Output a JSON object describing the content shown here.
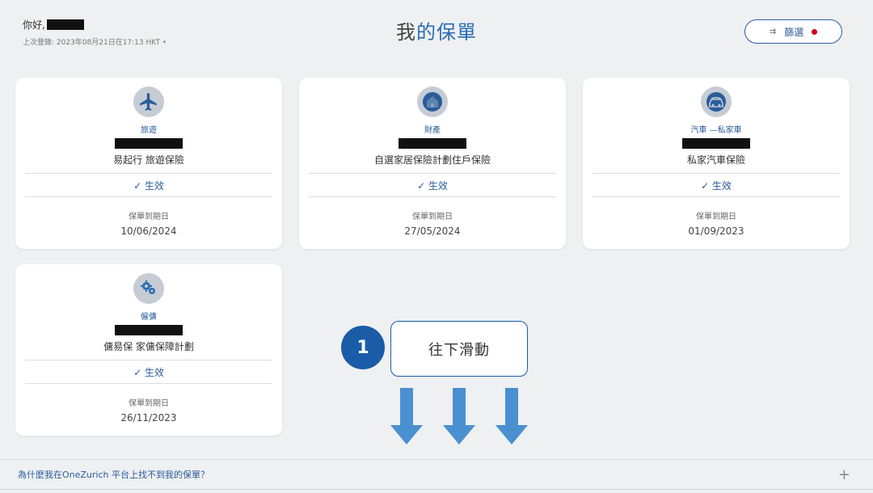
{
  "header": {
    "greeting": "你好,",
    "last_login": "上次登錄: 2023年08月21日在17:13 HKT •",
    "title_part1": "我",
    "title_part2": "的保單",
    "filter_label": "篩選",
    "filter_icon": "filter-icon"
  },
  "policies": [
    {
      "category": "旅遊",
      "product": "易起行 旅遊保險",
      "status": "✓ 生效",
      "expiry_label": "保單到期日",
      "expiry_date": "10/06/2024",
      "icon": "airplane-icon"
    },
    {
      "category": "財產",
      "product": "自選家居保險計劃住戶保險",
      "status": "✓ 生效",
      "expiry_label": "保單到期日",
      "expiry_date": "27/05/2024",
      "icon": "house-icon"
    },
    {
      "category": "汽車 —私家車",
      "product": "私家汽車保險",
      "status": "✓ 生效",
      "expiry_label": "保單到期日",
      "expiry_date": "01/09/2023",
      "icon": "car-icon"
    },
    {
      "category": "僱傭",
      "product": "傭易保 家傭保障計劃",
      "status": "✓ 生效",
      "expiry_label": "保單到期日",
      "expiry_date": "26/11/2023",
      "icon": "gears-icon"
    }
  ],
  "annotation": {
    "step_number": "1",
    "instruction": "往下滑動"
  },
  "faq": {
    "question": "為什麼我在OneZurich 平台上找不到我的保單？",
    "expand_icon": "+"
  },
  "colors": {
    "accent": "#2a5c9a",
    "badge": "#1a5ca8",
    "arrow": "#4a90d0",
    "notification_dot": "#d0021b"
  }
}
